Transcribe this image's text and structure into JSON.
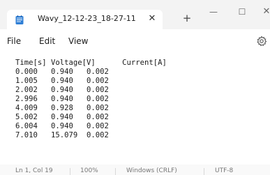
{
  "window": {
    "tab_title": "Wavy_12-12-23_18-27-11",
    "close_tab_symbol": "✕",
    "new_tab_symbol": "+",
    "minimize_symbol": "—",
    "maximize_symbol": "☐",
    "close_symbol": "✕",
    "icons": [
      "notepad-icon",
      "settings-icon"
    ]
  },
  "menu": {
    "file": "File",
    "edit": "Edit",
    "view": "View"
  },
  "editor": {
    "content": "Time[s] Voltage[V]      Current[A]\n0.000   0.940   0.002\n1.005   0.940   0.002\n2.002   0.940   0.002\n2.996   0.940   0.002\n4.009   0.928   0.002\n5.002   0.940   0.002\n6.004   0.940   0.002\n7.010   15.079  0.002"
  },
  "status": {
    "position": "Ln 1, Col 19",
    "zoom": "100%",
    "line_ending": "Windows (CRLF)",
    "encoding": "UTF-8"
  },
  "colors": {
    "titlebar_bg": "#f3f3f3",
    "tab_bg": "#ffffff",
    "notepad_icon_blue": "#2f7fd6"
  }
}
